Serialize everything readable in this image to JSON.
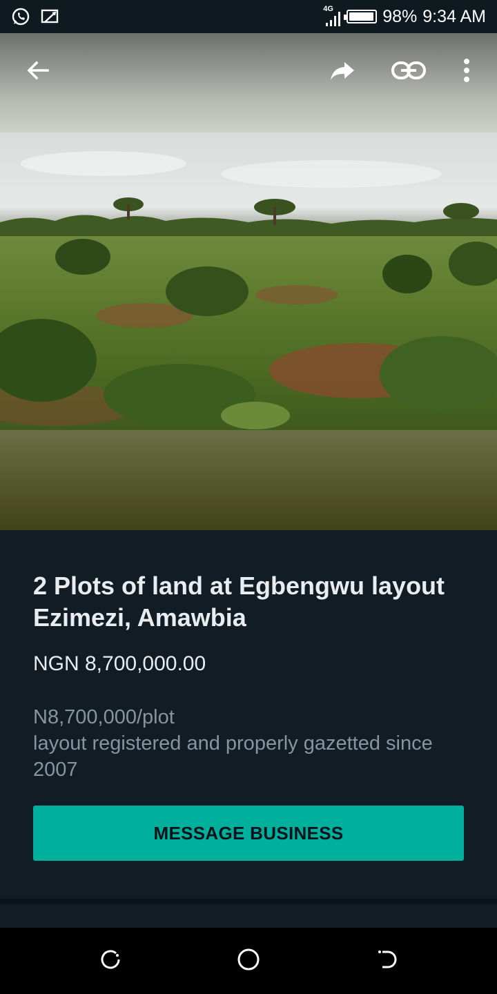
{
  "status_bar": {
    "network": "4G",
    "battery": "98%",
    "time": "9:34 AM",
    "left_icons": [
      "whatsapp-icon",
      "cast-icon"
    ]
  },
  "toolbar": {
    "back": "back-arrow-icon",
    "share": "forward-icon",
    "link": "link-icon",
    "more": "more-vertical-icon"
  },
  "product": {
    "title": "2 Plots of land at Egbengwu layout Ezimezi, Amawbia",
    "price": "NGN 8,700,000.00",
    "description": "N8,700,000/plot\nlayout registered and properly gazetted since 2007",
    "cta_label": "MESSAGE BUSINESS"
  },
  "nav": {
    "recents": "recents-icon",
    "home": "home-icon",
    "back": "back-nav-icon"
  },
  "colors": {
    "panel": "#111c24",
    "accent": "#00af9c",
    "title_text": "#e9edef",
    "secondary_text": "#8696a0"
  }
}
